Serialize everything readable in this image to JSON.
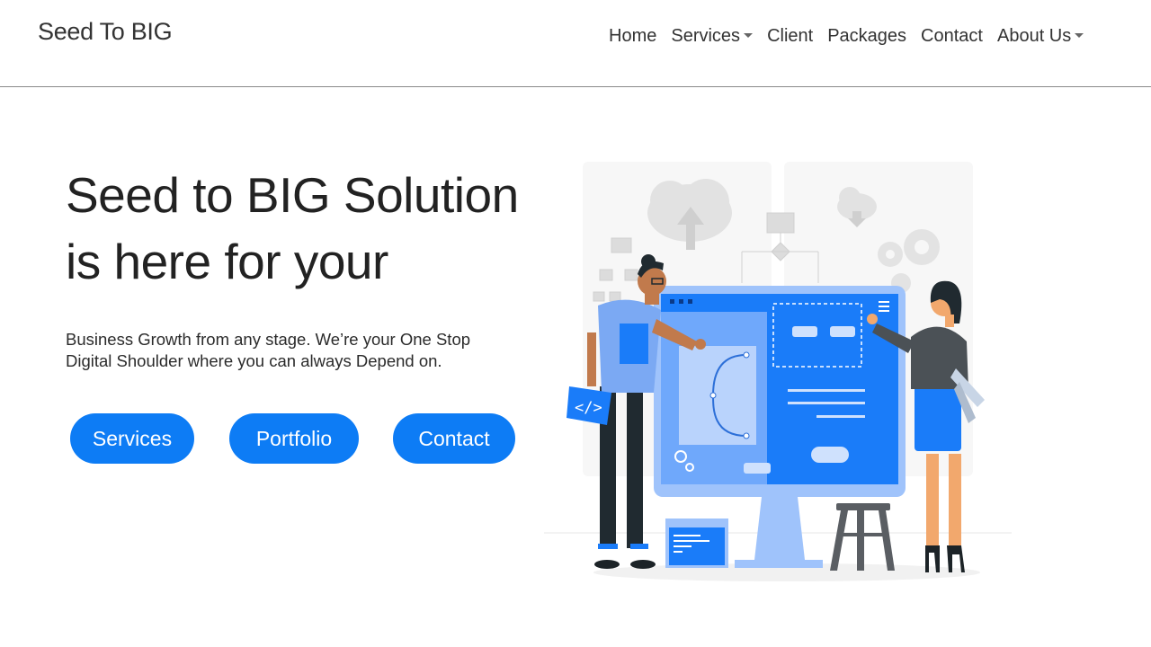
{
  "brand": "Seed To BIG",
  "nav": {
    "home": "Home",
    "services": "Services",
    "client": "Client",
    "packages": "Packages",
    "contact": "Contact",
    "about": "About Us"
  },
  "hero": {
    "title_line1": "Seed to BIG Solution",
    "title_line2": "is here for your",
    "subtitle_line1": "Business Growth from any stage. We’re your One Stop",
    "subtitle_line2": "Digital Shoulder where you can always Depend on."
  },
  "buttons": {
    "services": "Services",
    "portfolio": "Portfolio",
    "contact": "Contact"
  },
  "colors": {
    "accent": "#0d7cf5",
    "illustration_blue": "#1a7cf9",
    "illustration_light": "#9fc3fb"
  },
  "illustration": {
    "code_icon": "</>"
  }
}
